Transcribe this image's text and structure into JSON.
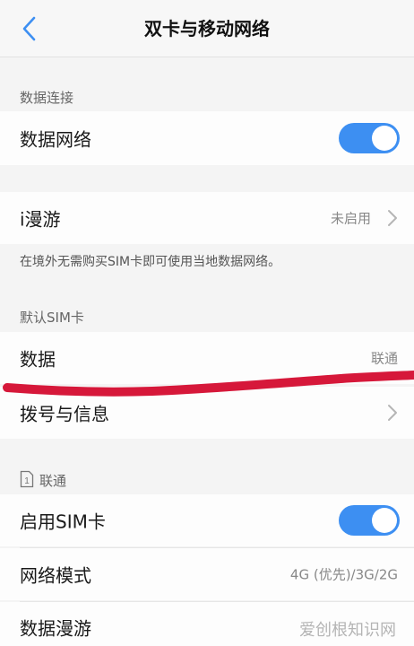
{
  "header": {
    "title": "双卡与移动网络",
    "back_icon": "chevron-left-icon"
  },
  "data_connection": {
    "section_title": "数据连接",
    "mobile_data": {
      "label": "数据网络",
      "enabled": true
    }
  },
  "iroaming": {
    "label": "i漫游",
    "value": "未启用",
    "note": "在境外无需购买SIM卡即可使用当地数据网络。"
  },
  "default_sim": {
    "section_title": "默认SIM卡",
    "data": {
      "label": "数据",
      "value": "联通"
    },
    "calls": {
      "label": "拨号与信息"
    }
  },
  "sim1": {
    "slot_number": "1",
    "section_title": "联通",
    "enable_sim": {
      "label": "启用SIM卡",
      "enabled": true
    },
    "network_mode": {
      "label": "网络模式",
      "value": "4G (优先)/3G/2G"
    },
    "data_roaming": {
      "label": "数据漫游"
    }
  },
  "watermark": "爱创根知识网",
  "colors": {
    "toggle_on": "#3d8ff2",
    "red_annotation": "#d6183a"
  }
}
